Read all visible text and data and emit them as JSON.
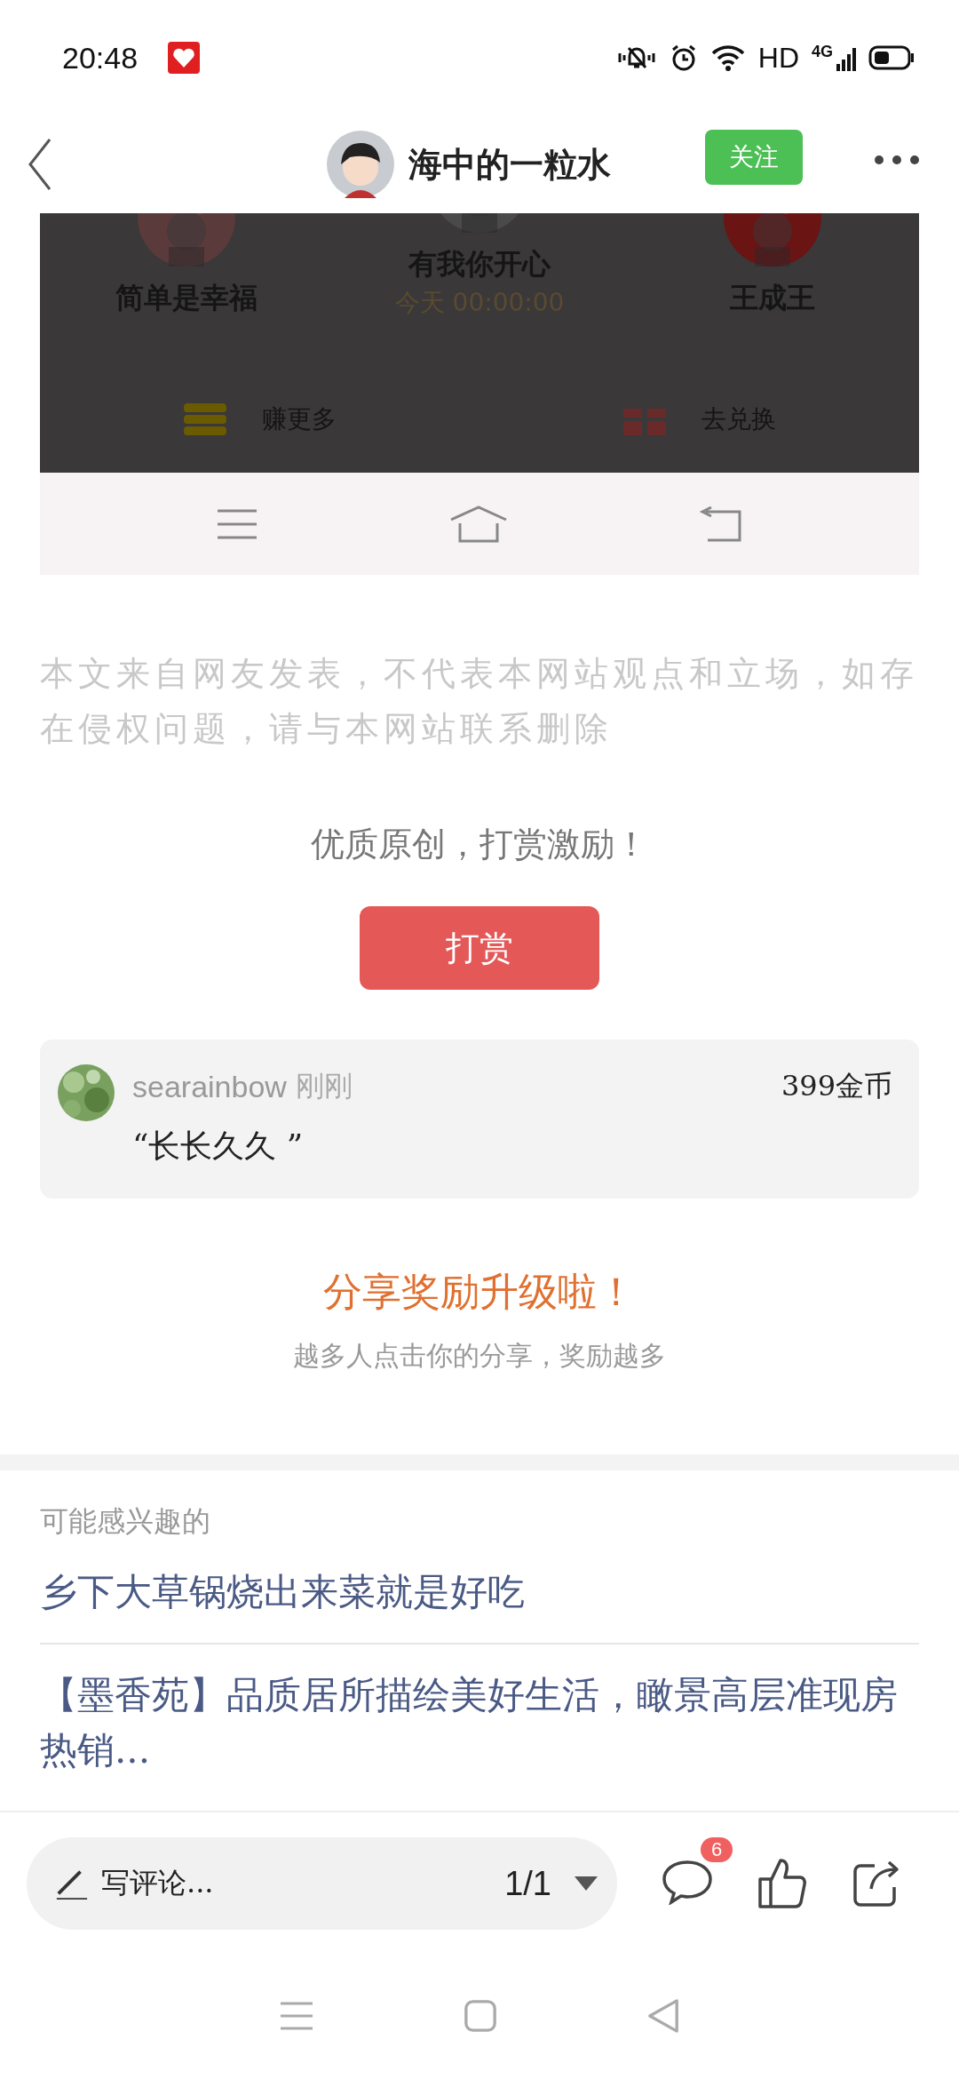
{
  "status_bar": {
    "time": "20:48",
    "hd": "HD",
    "network": "4G"
  },
  "header": {
    "author": "海中的一粒水",
    "follow_button": "关注"
  },
  "embedded_screenshot": {
    "users": [
      {
        "name": "简单是幸福"
      },
      {
        "name": "有我你开心",
        "time": "今天 00:00:00"
      },
      {
        "name": "王成王"
      }
    ],
    "actions": [
      {
        "label": "赚更多",
        "kind": "coins"
      },
      {
        "label": "去兑换",
        "kind": "gift"
      }
    ]
  },
  "disclaimer": "本文来自网友发表，不代表本网站观点和立场，如存在侵权问题，请与本网站联系删除",
  "reward": {
    "prompt": "优质原创，打赏激励！",
    "button": "打赏",
    "records": [
      {
        "user": "searainbow",
        "time": "刚刚",
        "amount": "399金币",
        "message": "“长长久久 ”"
      }
    ]
  },
  "share": {
    "title": "分享奖励升级啦！",
    "subtitle": "越多人点击你的分享，奖励越多"
  },
  "related": {
    "heading": "可能感兴趣的",
    "articles": [
      "乡下大草锅烧出来菜就是好吃",
      "【墨香苑】品质居所描绘美好生活，瞰景高层准现房热销..."
    ]
  },
  "bottom_bar": {
    "comment_placeholder": "写评论...",
    "page": "1/1",
    "comment_count": "6"
  }
}
